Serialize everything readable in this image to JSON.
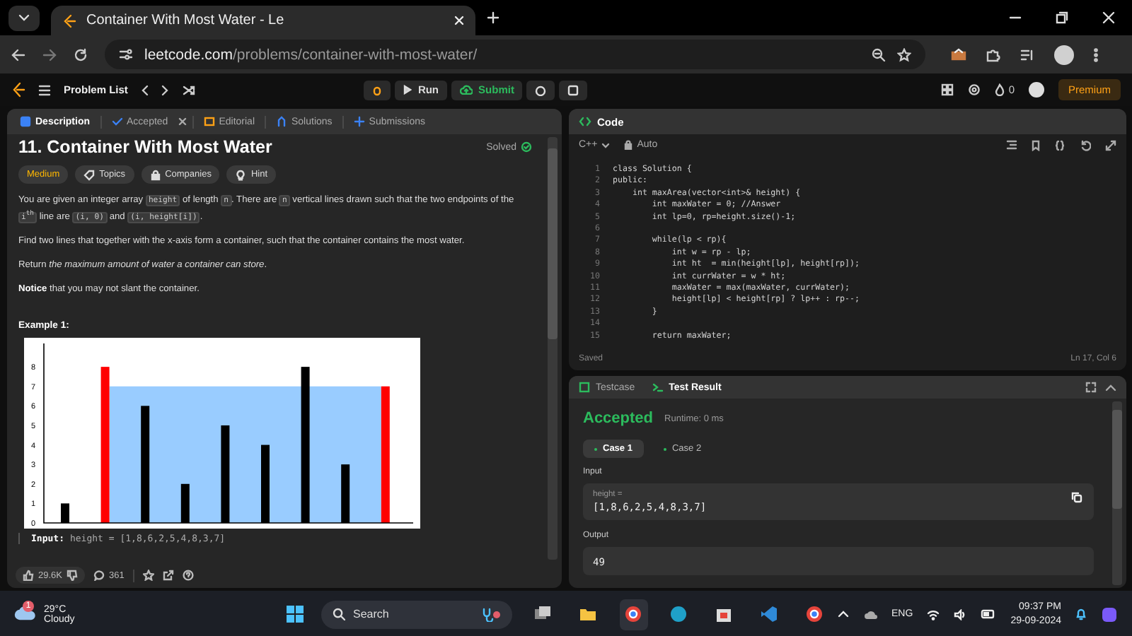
{
  "browser": {
    "tab_title": "Container With Most Water - Le",
    "url_host": "leetcode.com",
    "url_path": "/problems/container-with-most-water/"
  },
  "nav": {
    "problem_list": "Problem List",
    "run": "Run",
    "submit": "Submit",
    "streak": "0",
    "premium": "Premium"
  },
  "description": {
    "tabs": [
      {
        "label": "Description",
        "selected": true,
        "closable": false
      },
      {
        "label": "Accepted",
        "selected": false,
        "closable": true
      },
      {
        "label": "Editorial",
        "selected": false,
        "closable": false
      },
      {
        "label": "Solutions",
        "selected": false,
        "closable": false
      },
      {
        "label": "Submissions",
        "selected": false,
        "closable": false
      }
    ],
    "title": "11. Container With Most Water",
    "status": "Solved",
    "tags": [
      {
        "label": "Medium",
        "kind": "difficulty"
      },
      {
        "label": "Topics",
        "kind": "chip"
      },
      {
        "label": "Companies",
        "kind": "chip"
      },
      {
        "label": "Hint",
        "kind": "chip"
      }
    ],
    "paragraphs": [
      [
        {
          "kind": "text",
          "text": "You are given an integer array "
        },
        {
          "kind": "code",
          "text": "height"
        },
        {
          "kind": "text",
          "text": " of length "
        },
        {
          "kind": "code",
          "text": "n"
        },
        {
          "kind": "text",
          "text": ". There are "
        },
        {
          "kind": "code",
          "text": "n"
        },
        {
          "kind": "text",
          "text": " vertical lines drawn such that the two endpoints of the "
        },
        {
          "kind": "code",
          "text": "i$^{th}$"
        },
        {
          "kind": "text",
          "text": " line are "
        },
        {
          "kind": "code",
          "text": "(i, 0)"
        },
        {
          "kind": "text",
          "text": " and "
        },
        {
          "kind": "code",
          "text": "(i, height[i])"
        },
        {
          "kind": "text",
          "text": "."
        }
      ],
      [
        {
          "kind": "text",
          "text": "Find two lines that together with the x-axis form a container, such that the container contains the most water."
        }
      ],
      [
        {
          "kind": "text",
          "text": "Return *the maximum amount of water a container can store*."
        }
      ],
      [
        {
          "kind": "text",
          "text": "**Notice** that you may not slant the container."
        }
      ]
    ],
    "example_heading": "Example 1:",
    "chart_data": {
      "type": "bar",
      "series": [
        {
          "color": "#000000",
          "values": [
            1,
            null,
            6,
            2,
            5,
            4,
            8,
            3,
            null
          ]
        },
        {
          "color": "#ff0000",
          "values": [
            null,
            8,
            null,
            null,
            null,
            null,
            null,
            null,
            7
          ]
        }
      ],
      "ylim": [
        0,
        9.2
      ],
      "yticks": [
        0,
        1,
        2,
        3,
        4,
        5,
        6,
        7,
        8
      ],
      "stacked": true
    },
    "input_label": "Input:",
    "input_value": "height = [1,8,6,2,5,4,8,3,7]",
    "likes": "29.6K",
    "comments": "361"
  },
  "code": {
    "title": "Code",
    "language": "C++",
    "mode": "Auto",
    "lines": [
      {
        "number": "1",
        "text": "class Solution {"
      },
      {
        "number": "2",
        "text": "public:"
      },
      {
        "number": "3",
        "text": "    int maxArea(vector<int>& height) {"
      },
      {
        "number": "4",
        "text": "        int maxWater = 0; //Answer"
      },
      {
        "number": "5",
        "text": "        int lp=0, rp=height.size()-1;"
      },
      {
        "number": "6"
      },
      {
        "number": "7",
        "text": "        while(lp < rp){"
      },
      {
        "number": "8",
        "text": "            int w = rp - lp;"
      },
      {
        "number": "9",
        "text": "            int ht  = min(height[lp], height[rp]);"
      },
      {
        "number": "10",
        "text": "            int currWater = w * ht;"
      },
      {
        "number": "11",
        "text": "            maxWater = max(maxWater, currWater);"
      },
      {
        "number": "12",
        "text": "            height[lp] < height[rp] ? lp++ : rp--;"
      },
      {
        "number": "13",
        "text": "        }"
      },
      {
        "number": "14"
      },
      {
        "number": "15",
        "text": "        return maxWater;"
      }
    ],
    "saved": "Saved",
    "cursor": "Ln 17, Col 6"
  },
  "result": {
    "tabs": [
      {
        "label": "Testcase",
        "selected": false
      },
      {
        "label": "Test Result",
        "selected": true
      }
    ],
    "verdict": "Accepted",
    "runtime": "Runtime: 0 ms",
    "cases": [
      {
        "label": "Case 1",
        "selected": true
      },
      {
        "label": "Case 2",
        "selected": false
      }
    ],
    "input_label": "Input",
    "param": "height =",
    "input_value": "[1,8,6,2,5,4,8,3,7]",
    "output_label": "Output",
    "output_value": "49"
  },
  "taskbar": {
    "temperature": "29°C",
    "weather": "Cloudy",
    "weather_badge": "1",
    "search": "Search",
    "language": "ENG",
    "time": "09:37 PM",
    "date": "29-09-2024"
  }
}
